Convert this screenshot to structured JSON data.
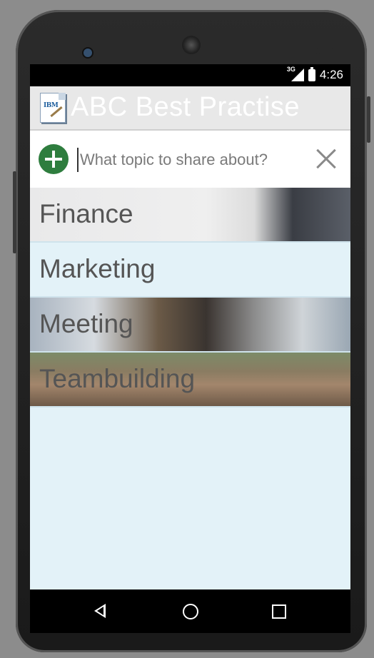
{
  "status": {
    "network": "3G",
    "time": "4:26"
  },
  "app": {
    "title": "ABC Best Practise",
    "icon_text": "IBM"
  },
  "search": {
    "placeholder": "What topic to share about?",
    "value": ""
  },
  "topics": [
    {
      "label": "Finance"
    },
    {
      "label": "Marketing"
    },
    {
      "label": "Meeting"
    },
    {
      "label": "Teambuilding"
    }
  ],
  "colors": {
    "accent_green": "#2e7d3e",
    "list_bg": "#e3f2f8",
    "appbar_bg": "#e8e8e8"
  },
  "icons": {
    "add": "plus-circle-icon",
    "clear": "close-icon",
    "back": "back-triangle-icon",
    "home": "home-circle-icon",
    "recent": "recent-square-icon"
  }
}
